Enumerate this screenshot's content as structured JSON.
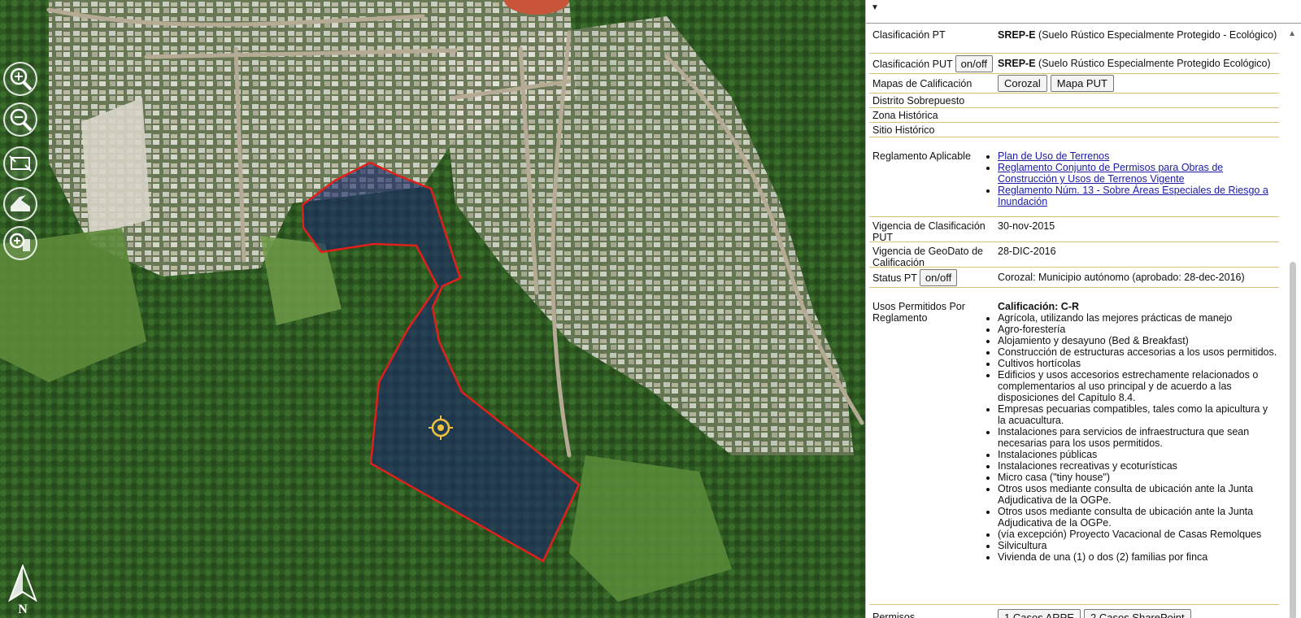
{
  "map": {
    "tools": [
      {
        "name": "zoom-in-icon"
      },
      {
        "name": "zoom-out-icon"
      },
      {
        "name": "full-extent-icon"
      },
      {
        "name": "measure-icon"
      },
      {
        "name": "zoom-to-layer-icon"
      }
    ],
    "north_label": "N",
    "colors": {
      "parcel_outline": "#e0201a",
      "parcel_fill": "#1b2a6b",
      "vegetation": "#2f5a24"
    }
  },
  "panel": {
    "rows": {
      "clasificacion_pt": {
        "label": "Clasificación PT",
        "code": "SREP-E",
        "desc": "(Suelo Rústico Especialmente Protegido - Ecológico)"
      },
      "clasificacion_put": {
        "label": "Clasificación PUT",
        "toggle": "on/off",
        "code": "SREP-E",
        "desc": "(Suelo Rústico Especialmente Protegido Ecológico)"
      },
      "mapas": {
        "label": "Mapas de Calificación",
        "btn1": "Corozal",
        "btn2": "Mapa PUT"
      },
      "distrito": {
        "label": "Distrito Sobrepuesto"
      },
      "zona": {
        "label": "Zona Histórica"
      },
      "sitio": {
        "label": "Sitio Histórico"
      },
      "reglamento": {
        "label": "Reglamento Aplicable",
        "links": [
          "Plan de Uso de Terrenos",
          "Reglamento Conjunto de Permisos para Obras de Construcción y Usos de Terrenos Vigente",
          "Reglamento Núm. 13 - Sobre Áreas Especiales de Riesgo a Inundación"
        ]
      },
      "vigencia_put": {
        "label": "Vigencia de Clasificación PUT",
        "value": "30-nov-2015"
      },
      "vigencia_geo": {
        "label": "Vigencia de GeoDato de Calificación",
        "value": "28-DIC-2016"
      },
      "status_pt": {
        "label": "Status PT",
        "toggle": "on/off",
        "value": "Corozal: Municipio autónomo (aprobado: 28-dec-2016)"
      },
      "usos": {
        "label": "Usos Permitidos Por Reglamento",
        "heading": "Calificación: C-R",
        "items": [
          "Agrícola, utilizando las mejores prácticas de manejo",
          "Agro-forestería",
          "Alojamiento y desayuno (Bed & Breakfast)",
          "Construcción de estructuras accesorias a los usos permitidos.",
          "Cultivos hortícolas",
          "Edificios y usos accesorios estrechamente relacionados o complementarios al uso principal y de acuerdo a las disposiciones del Capítulo 8.4.",
          "Empresas pecuarias compatibles, tales como la apicultura y la acuacultura.",
          "Instalaciones para servicios de infraestructura que sean necesarias para los usos permitidos.",
          "Instalaciones públicas",
          "Instalaciones recreativas y ecoturísticas",
          "Micro casa (\"tiny house\")",
          "Otros usos mediante consulta de ubicación ante la Junta Adjudicativa de la OGPe.",
          "Otros usos mediante consulta de ubicación ante la Junta Adjudicativa de la OGPe.",
          "(vía excepción) Proyecto Vacacional de Casas Remolques",
          "Silvicultura",
          "Vivienda de una (1) o dos (2) familias por finca"
        ]
      },
      "permisos": {
        "label": "Permisos",
        "btn1": "1 Casos ARPE",
        "btn2": "2 Casos SharePoint"
      }
    }
  }
}
